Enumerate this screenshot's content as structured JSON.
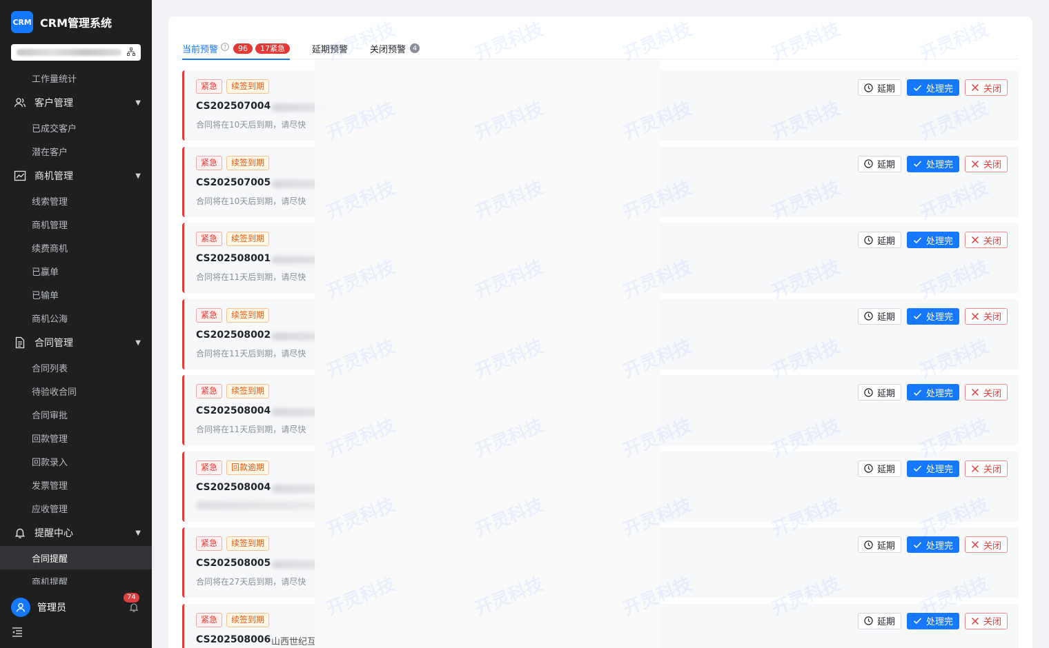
{
  "app": {
    "logo": "CRM",
    "title": "CRM管理系统"
  },
  "sidebar": {
    "top_item": "工作量统计",
    "groups": [
      {
        "label": "客户管理",
        "icon": "users-icon",
        "items": [
          "已成交客户",
          "潜在客户"
        ]
      },
      {
        "label": "商机管理",
        "icon": "chart-icon",
        "items": [
          "线索管理",
          "商机管理",
          "续费商机",
          "已赢单",
          "已输单",
          "商机公海"
        ]
      },
      {
        "label": "合同管理",
        "icon": "document-icon",
        "items": [
          "合同列表",
          "待验收合同",
          "合同审批",
          "回款管理",
          "回款录入",
          "发票管理",
          "应收管理"
        ]
      },
      {
        "label": "提醒中心",
        "icon": "bell-icon",
        "items": [
          "合同提醒",
          "商机提醒"
        ]
      }
    ],
    "active_item": "合同提醒",
    "user_name": "管理员",
    "notify_count": "74"
  },
  "tabs": [
    {
      "label": "当前预警",
      "count": "96",
      "urgent": "17紧急"
    },
    {
      "label": "延期预警"
    },
    {
      "label": "关闭预警",
      "count": "4"
    }
  ],
  "actions": {
    "delay": "延期",
    "done": "处理完",
    "close": "关闭"
  },
  "urgent_label": "紧急",
  "alerts": [
    {
      "type": "续签到期",
      "code": "CS202507004",
      "client": "",
      "desc": "合同将在10天后到期，请尽快"
    },
    {
      "type": "续签到期",
      "code": "CS202507005",
      "client": "",
      "desc": "合同将在10天后到期，请尽快"
    },
    {
      "type": "续签到期",
      "code": "CS202508001",
      "client": "",
      "desc": "合同将在11天后到期，请尽快"
    },
    {
      "type": "续签到期",
      "code": "CS202508002",
      "client": "",
      "desc": "合同将在11天后到期，请尽快"
    },
    {
      "type": "续签到期",
      "code": "CS202508004",
      "client": "",
      "desc": "合同将在11天后到期，请尽快"
    },
    {
      "type": "回款逾期",
      "code": "CS202508004",
      "client": "",
      "desc": ""
    },
    {
      "type": "续签到期",
      "code": "CS202508005",
      "client": "",
      "desc": "合同将在27天后到期，请尽快"
    },
    {
      "type": "续签到期",
      "code": "CS202508006",
      "client": "山西世纪互",
      "desc": ""
    }
  ],
  "watermark": "开灵科技",
  "colors": {
    "primary": "#1677ff",
    "danger": "#e53935",
    "sidebar_bg": "#1f1f20"
  }
}
